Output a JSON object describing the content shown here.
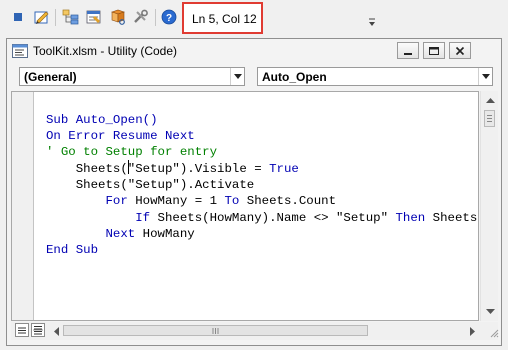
{
  "toolbar": {
    "buttons": [
      {
        "name": "stop-icon"
      },
      {
        "name": "design-mode-icon"
      },
      {
        "name": "project-explorer-icon"
      },
      {
        "name": "properties-window-icon"
      },
      {
        "name": "object-browser-icon"
      },
      {
        "name": "toolbox-icon"
      },
      {
        "name": "help-icon"
      }
    ],
    "status": "Ln 5, Col 12",
    "status_highlight_color": "#e03b32"
  },
  "window": {
    "title": "ToolKit.xlsm - Utility (Code)",
    "object_combo": "(General)",
    "procedure_combo": "Auto_Open"
  },
  "code": {
    "lines": [
      [
        {
          "t": "Sub Auto_Open()",
          "c": "kw"
        }
      ],
      [
        {
          "t": "On Error Resume Next",
          "c": "kw"
        }
      ],
      [
        {
          "t": "' Go to Setup for entry",
          "c": "cm"
        }
      ],
      [
        {
          "t": "    Sheets(",
          "c": ""
        },
        {
          "caret": true
        },
        {
          "t": "\"Setup\").Visible = ",
          "c": ""
        },
        {
          "t": "True",
          "c": "kw"
        }
      ],
      [
        {
          "t": "    Sheets(\"Setup\").Activate",
          "c": ""
        }
      ],
      [
        {
          "t": "        ",
          "c": ""
        },
        {
          "t": "For",
          "c": "kw"
        },
        {
          "t": " HowMany = 1 ",
          "c": ""
        },
        {
          "t": "To",
          "c": "kw"
        },
        {
          "t": " Sheets.Count",
          "c": ""
        }
      ],
      [
        {
          "t": "            ",
          "c": ""
        },
        {
          "t": "If",
          "c": "kw"
        },
        {
          "t": " Sheets(HowMany).Name <> \"Setup\" ",
          "c": ""
        },
        {
          "t": "Then",
          "c": "kw"
        },
        {
          "t": " Sheets(HowMany).Visible = False",
          "c": ""
        }
      ],
      [
        {
          "t": "        ",
          "c": ""
        },
        {
          "t": "Next",
          "c": "kw"
        },
        {
          "t": " HowMany",
          "c": ""
        }
      ],
      [
        {
          "t": "End Sub",
          "c": "kw"
        }
      ]
    ],
    "colors": {
      "keyword": "#0000b3",
      "comment": "#008000",
      "text": "#000000"
    }
  }
}
